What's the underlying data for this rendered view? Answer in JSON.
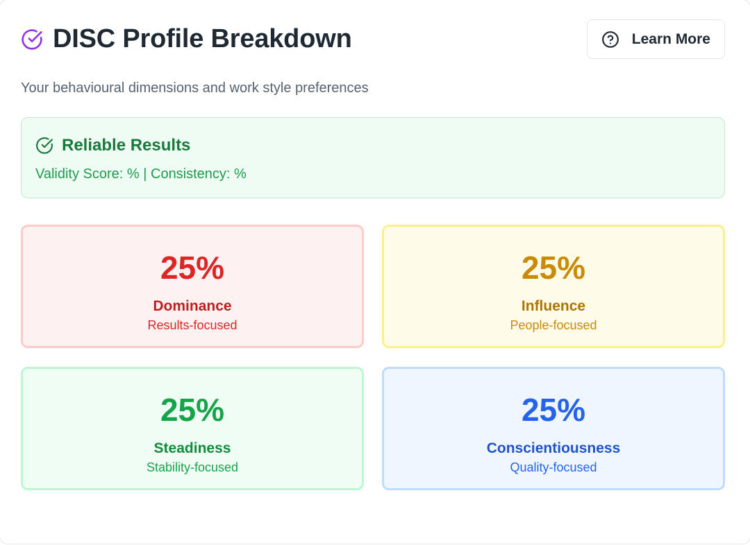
{
  "header": {
    "title": "DISC Profile Breakdown",
    "title_icon": "circle-check-icon",
    "learn_more_label": "Learn More",
    "learn_more_icon": "question-circle-icon"
  },
  "subtitle": "Your behavioural dimensions and work style preferences",
  "reliability": {
    "icon": "circle-check-icon",
    "title": "Reliable Results",
    "text": "Validity Score: % | Consistency: %"
  },
  "dimensions": [
    {
      "percent": "25%",
      "name": "Dominance",
      "focus": "Results-focused",
      "color": "#dc2626",
      "bg": "#fef1f1",
      "border": "#fecaca"
    },
    {
      "percent": "25%",
      "name": "Influence",
      "focus": "People-focused",
      "color": "#ca8a04",
      "bg": "#fefce8",
      "border": "#fdef8a"
    },
    {
      "percent": "25%",
      "name": "Steadiness",
      "focus": "Stability-focused",
      "color": "#16a34a",
      "bg": "#f0fdf4",
      "border": "#bbf7d0"
    },
    {
      "percent": "25%",
      "name": "Conscientiousness",
      "focus": "Quality-focused",
      "color": "#2563eb",
      "bg": "#eff6ff",
      "border": "#bfdbfe"
    }
  ],
  "colors": {
    "accent_purple": "#9333ea",
    "success_green": "#177a3c"
  }
}
